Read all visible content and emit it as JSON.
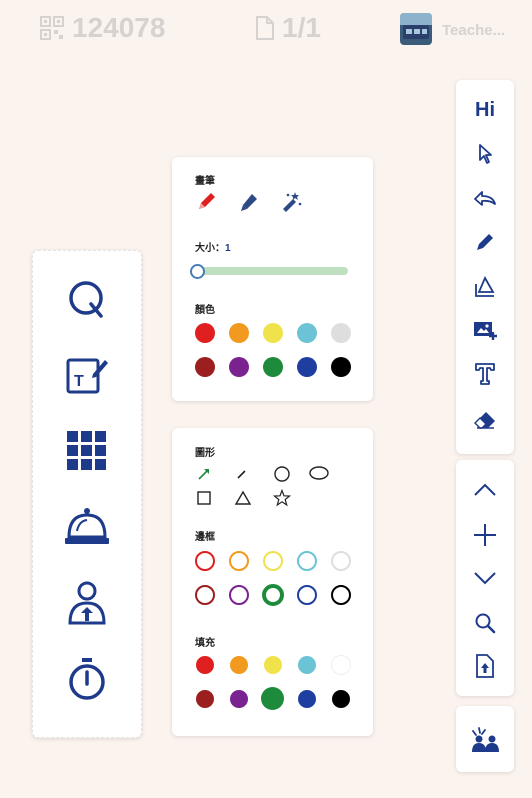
{
  "header": {
    "room_code": "124078",
    "page_indicator": "1/1",
    "user_name": "Teache..."
  },
  "left_toolbar": {
    "items": [
      {
        "icon": "quiz-icon"
      },
      {
        "icon": "note-edit-icon"
      },
      {
        "icon": "grid-apps-icon"
      },
      {
        "icon": "bell-icon"
      },
      {
        "icon": "student-icon"
      },
      {
        "icon": "timer-icon"
      }
    ]
  },
  "pen_panel": {
    "title": "畫筆",
    "tools": [
      "pen-icon",
      "highlighter-icon",
      "magic-wand-icon"
    ],
    "size_label": "大小：",
    "size_value": "1",
    "size_fraction": 0.0,
    "color_label": "顏色",
    "colors": [
      "#e02020",
      "#f29a1f",
      "#efe24a",
      "#6cc3d5",
      "#dedede",
      "#9b1f1f",
      "#7a228f",
      "#1e8a3c",
      "#1f3fa0",
      "#000000"
    ]
  },
  "shape_panel": {
    "title": "圖形",
    "shapes": [
      "arrow-icon",
      "line-icon",
      "circle-icon",
      "ellipse-icon",
      "square-icon",
      "triangle-icon",
      "star-icon"
    ],
    "border_label": "邊框",
    "border_colors": [
      "#e02020",
      "#f29a1f",
      "#efe24a",
      "#6cc3d5",
      "#dedede",
      "#9b1f1f",
      "#7a228f",
      "#1e8a3c",
      "#1f3fa0",
      "#000000"
    ],
    "fill_label": "填充",
    "fill_colors": [
      "#e02020",
      "#f29a1f",
      "#efe24a",
      "#6cc3d5",
      "#ffffff",
      "#9b1f1f",
      "#7a228f",
      "#1e8a3c",
      "#1f3fa0",
      "#000000"
    ]
  },
  "right_toolbar": {
    "hi_label": "Hi",
    "tools": [
      "pointer-icon",
      "undo-icon",
      "pen-icon",
      "eraser-shapes-icon",
      "add-image-icon",
      "text-icon",
      "eraser-icon"
    ],
    "nav": [
      "chevron-up-icon",
      "plus-icon",
      "chevron-down-icon",
      "search-icon",
      "upload-file-icon"
    ],
    "bottom": "classroom-icon"
  },
  "colors": {
    "brand": "#1e3a8a",
    "slider_track": "#bfe0c0"
  }
}
